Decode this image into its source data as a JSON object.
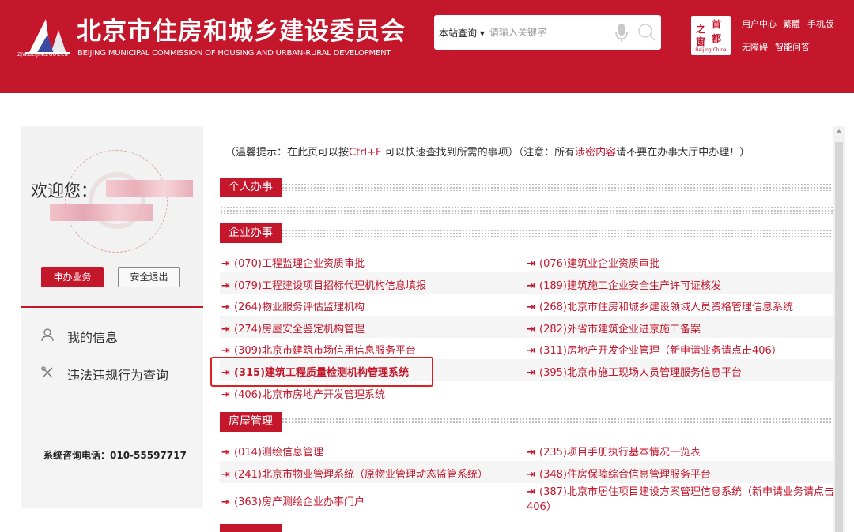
{
  "header": {
    "url": "ZJW.BEIJING.GOV.CN",
    "title": "北京市住房和城乡建设委员会",
    "subtitle": "BEIJING MUNICIPAL COMMISSION OF HOUSING AND URBAN-RURAL DEVELOPMENT",
    "search_scope": "本站查询",
    "search_placeholder": "请输入关键字",
    "capital_logo": {
      "c1": "首",
      "c2": "都",
      "c3": "之",
      "c4": "窗",
      "sub": "Beijing·China"
    },
    "links": {
      "user_center": "用户中心",
      "traditional": "繁體",
      "mobile": "手机版",
      "accessible": "无障碍",
      "smart_qa": "智能问答"
    }
  },
  "sidebar": {
    "welcome": "欢迎您：",
    "apply_button": "申办业务",
    "logout_button": "安全退出",
    "menu": [
      {
        "label": "我的信息"
      },
      {
        "label": "违法违规行为查询"
      }
    ],
    "hotline": "系统咨询电话：010-55597717"
  },
  "tip": {
    "part1": "（温馨提示：在此页可以按",
    "hotkey": "Ctrl+F",
    "part2": " 可以快速查找到所需的事项）（注意：所有",
    "secret": "涉密内容",
    "part3": "请不要在办事大厅中办理！）"
  },
  "sections": {
    "personal": "个人办事",
    "enterprise": "企业办事",
    "housing": "房屋管理"
  },
  "enterprise_items": [
    [
      "(070)工程监理企业资质审批",
      "(076)建筑业企业资质审批"
    ],
    [
      "(079)工程建设项目招标代理机构信息填报",
      "(189)建筑施工企业安全生产许可证核发"
    ],
    [
      "(264)物业服务评估监理机构",
      "(268)北京市住房和城乡建设领域人员资格管理信息系统"
    ],
    [
      "(274)房屋安全鉴定机构管理",
      "(282)外省市建筑企业进京施工备案"
    ],
    [
      "(309)北京市建筑市场信用信息服务平台",
      "(311)房地产开发企业管理（新申请业务请点击406）"
    ],
    [
      "(315)建筑工程质量检测机构管理系统",
      "(395)北京市施工现场人员管理服务信息平台"
    ],
    [
      "(406)北京市房地产开发管理系统",
      ""
    ]
  ],
  "housing_items": [
    [
      "(014)测绘信息管理",
      "(235)项目手册执行基本情况一览表"
    ],
    [
      "(241)北京市物业管理系统（原物业管理动态监管系统）",
      "(348)住房保障综合信息管理服务平台"
    ],
    [
      "(363)房产测绘企业办事门户",
      "(387)北京市居住项目建设方案管理信息系统（新申请业务请点击406）"
    ]
  ],
  "arrow_glyph": "⇥",
  "colors": {
    "brand_red": "#c4172c",
    "highlight": "#e02020"
  }
}
